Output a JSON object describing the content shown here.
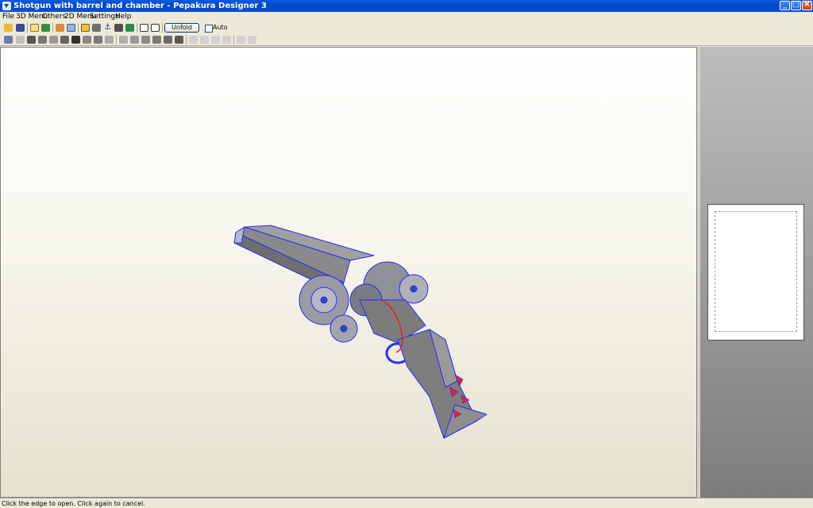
{
  "window": {
    "title": "Shotgun with barrel and chamber - Pepakura Designer 3"
  },
  "menu": [
    "File",
    "3D Menu",
    "Others",
    "2D Menu",
    "Settings",
    "Help"
  ],
  "toolbar": {
    "unfold_label": "Unfold",
    "auto_label": "Auto",
    "auto_checked": false
  },
  "status": {
    "text": "Click the edge to open. Click again to cancel."
  },
  "icons": {
    "open": "open-folder-icon",
    "save": "save-disk-icon",
    "light": "lightbulb-icon",
    "texture": "texture-cube-icon",
    "unfold_tool": "unfold-tool-icon",
    "edit": "edit-pencil-icon",
    "anchor": "anchor-icon"
  },
  "colors": {
    "titlebar": "#0a5be0",
    "model_fill": "#8c8c8c",
    "model_edges": "#2a2aff",
    "cut_lines": "#e8202a"
  }
}
